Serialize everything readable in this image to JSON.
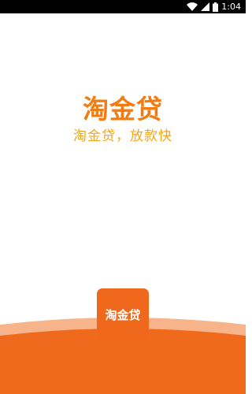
{
  "status_bar": {
    "time": "1:04",
    "icons": [
      "wifi-icon",
      "signal-icon",
      "battery-icon"
    ]
  },
  "splash": {
    "brand_title": "淘金贷",
    "slogan": "淘金贷，放款快",
    "app_icon_label": "淘金贷"
  },
  "colors": {
    "brand_orange": "#f27b12",
    "slogan_yellow": "#f5a51b",
    "icon_bg": "#f0681c",
    "wave_dark": "#ef6a1d",
    "wave_light": "#f7b48a"
  }
}
